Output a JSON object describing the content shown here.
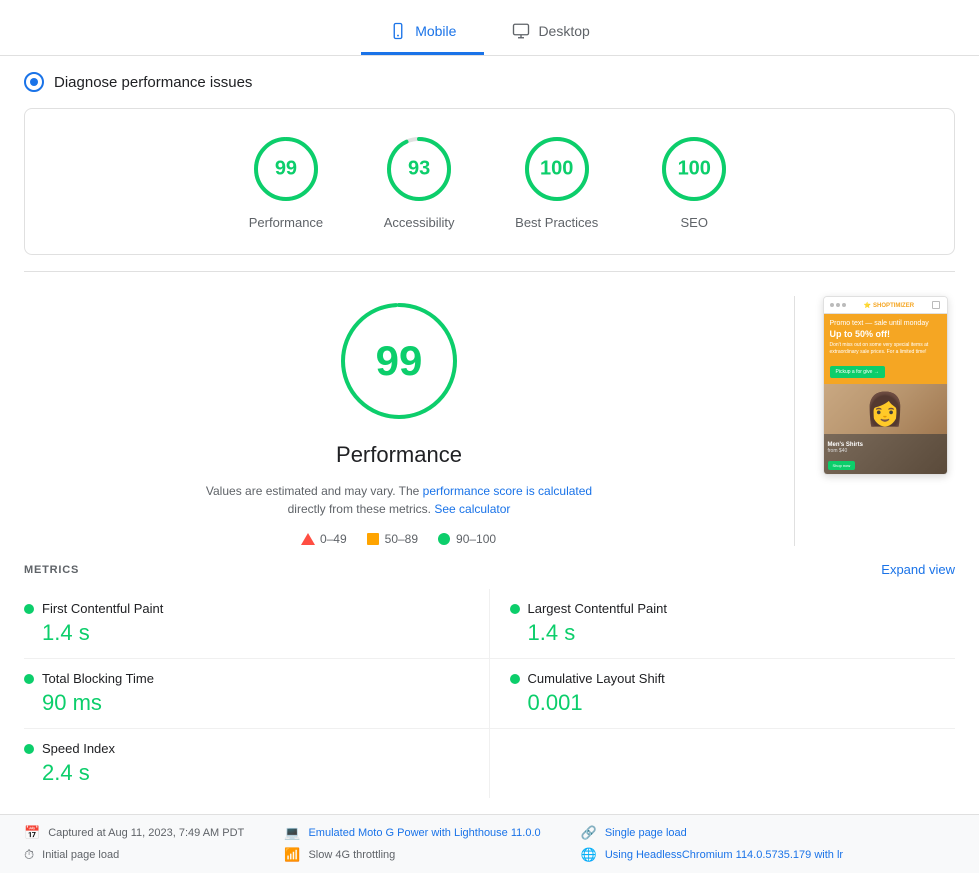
{
  "tabs": [
    {
      "id": "mobile",
      "label": "Mobile",
      "active": true
    },
    {
      "id": "desktop",
      "label": "Desktop",
      "active": false
    }
  ],
  "diagnose": {
    "title": "Diagnose performance issues"
  },
  "scores": [
    {
      "id": "performance",
      "value": 99,
      "label": "Performance",
      "pct": 99
    },
    {
      "id": "accessibility",
      "value": 93,
      "label": "Accessibility",
      "pct": 93
    },
    {
      "id": "best-practices",
      "value": 100,
      "label": "Best Practices",
      "pct": 100
    },
    {
      "id": "seo",
      "value": 100,
      "label": "SEO",
      "pct": 100
    }
  ],
  "main_score": {
    "value": 99,
    "label": "Performance",
    "note_text": "Values are estimated and may vary. The ",
    "note_link1": "performance score is calculated",
    "note_link1_url": "#",
    "note_mid": " directly from these metrics. ",
    "note_link2": "See calculator",
    "note_link2_url": "#"
  },
  "legend": [
    {
      "id": "low",
      "range": "0–49",
      "type": "triangle"
    },
    {
      "id": "medium",
      "range": "50–89",
      "type": "square"
    },
    {
      "id": "high",
      "range": "90–100",
      "type": "circle"
    }
  ],
  "metrics": {
    "title": "METRICS",
    "expand_label": "Expand view",
    "items": [
      {
        "id": "fcp",
        "label": "First Contentful Paint",
        "value": "1.4 s"
      },
      {
        "id": "lcp",
        "label": "Largest Contentful Paint",
        "value": "1.4 s"
      },
      {
        "id": "tbt",
        "label": "Total Blocking Time",
        "value": "90 ms"
      },
      {
        "id": "cls",
        "label": "Cumulative Layout Shift",
        "value": "0.001"
      },
      {
        "id": "si",
        "label": "Speed Index",
        "value": "2.4 s"
      }
    ]
  },
  "footer": {
    "captured": "Captured at Aug 11, 2023, 7:49 AM PDT",
    "initial_load": "Initial page load",
    "emulated": "Emulated Moto G Power with Lighthouse 11.0.0",
    "throttling": "Slow 4G throttling",
    "single_page": "Single page load",
    "browser": "Using HeadlessChromium 114.0.5735.179 with lr"
  },
  "screenshot": {
    "banner_title": "Up to 50% off!",
    "banner_sub": "Don't miss out on some very special items at extraordinary sale prices. For a limited time!",
    "btn_label": "Pickup a for give →",
    "img2_text": "Men's Shirts",
    "img2_sub": "from $40",
    "img2_btn": "Shop now"
  }
}
